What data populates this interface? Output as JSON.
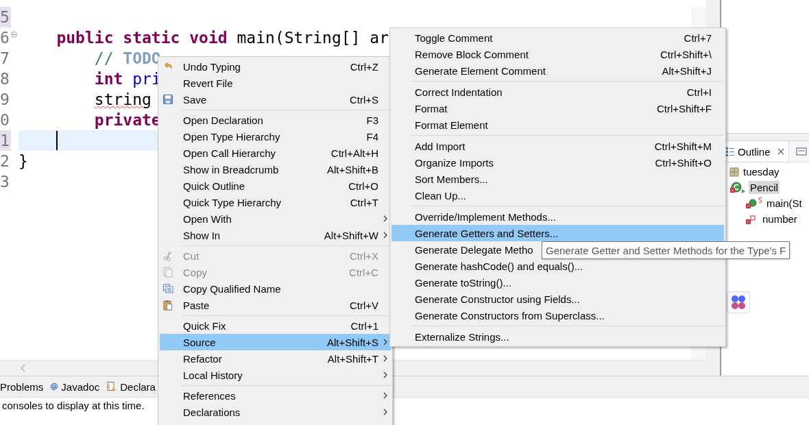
{
  "editor": {
    "lines": [
      {
        "number": "5",
        "marked": true,
        "folding": false,
        "current": false
      },
      {
        "number": "6",
        "marked": false,
        "folding": true,
        "current": false,
        "tokens": [
          {
            "text": "    public static void",
            "kind": "keyword"
          },
          {
            "text": " main(String[] ar",
            "kind": "plain"
          }
        ]
      },
      {
        "number": "7",
        "marked": false,
        "folding": false,
        "current": false,
        "tokens": [
          {
            "text": "        // ",
            "kind": "comment"
          },
          {
            "text": "TODO",
            "kind": "task"
          }
        ]
      },
      {
        "number": "8",
        "marked": false,
        "folding": false,
        "current": false,
        "tokens": [
          {
            "text": "        int",
            "kind": "keyword"
          },
          {
            "text": " pri",
            "kind": "field"
          }
        ]
      },
      {
        "number": "9",
        "marked": false,
        "folding": false,
        "current": false,
        "tokens": [
          {
            "text": "        string",
            "kind": "error"
          }
        ]
      },
      {
        "number": "0",
        "marked": false,
        "folding": false,
        "current": false,
        "tokens": [
          {
            "text": "        private",
            "kind": "keyword"
          }
        ]
      },
      {
        "number": "1",
        "marked": true,
        "folding": false,
        "current": true
      },
      {
        "number": "2",
        "marked": false,
        "folding": false,
        "current": false,
        "tokens": [
          {
            "text": "}",
            "kind": "plain"
          }
        ]
      },
      {
        "number": "3",
        "marked": false,
        "folding": false,
        "current": false
      }
    ]
  },
  "outline": {
    "tab": {
      "label": "Outline"
    },
    "items": [
      {
        "label": "tuesday",
        "kind": "package",
        "selected": false
      },
      {
        "label": "Pencil",
        "kind": "class",
        "selected": true,
        "children": [
          {
            "label": "main(St",
            "kind": "method",
            "static": true,
            "selected": false
          },
          {
            "label": "number",
            "kind": "field",
            "static": false,
            "selected": false
          }
        ]
      }
    ]
  },
  "bottom_panel": {
    "tabs": [
      {
        "label": "Problems",
        "kind": "plain"
      },
      {
        "label": "Javadoc",
        "kind": "javadoc"
      },
      {
        "label": "Declara",
        "kind": "declaration"
      }
    ],
    "message": "consoles to display at this time."
  },
  "context_menu": {
    "groups": [
      {
        "items": [
          {
            "label": "Undo Typing",
            "shortcut": "Ctrl+Z",
            "kind": "undo",
            "disabled": false,
            "selected": false,
            "submenu": false
          },
          {
            "label": "Revert File",
            "kind": "plain",
            "disabled": false,
            "selected": false,
            "submenu": false
          },
          {
            "label": "Save",
            "shortcut": "Ctrl+S",
            "kind": "save",
            "disabled": false,
            "selected": false,
            "submenu": false
          }
        ]
      },
      {
        "items": [
          {
            "label": "Open Declaration",
            "shortcut": "F3",
            "kind": "plain",
            "disabled": false,
            "selected": false,
            "submenu": false
          },
          {
            "label": "Open Type Hierarchy",
            "shortcut": "F4",
            "kind": "plain",
            "disabled": false,
            "selected": false,
            "submenu": false
          },
          {
            "label": "Open Call Hierarchy",
            "shortcut": "Ctrl+Alt+H",
            "kind": "plain",
            "disabled": false,
            "selected": false,
            "submenu": false
          },
          {
            "label": "Show in Breadcrumb",
            "shortcut": "Alt+Shift+B",
            "kind": "plain",
            "disabled": false,
            "selected": false,
            "submenu": false
          },
          {
            "label": "Quick Outline",
            "shortcut": "Ctrl+O",
            "kind": "plain",
            "disabled": false,
            "selected": false,
            "submenu": false
          },
          {
            "label": "Quick Type Hierarchy",
            "shortcut": "Ctrl+T",
            "kind": "plain",
            "disabled": false,
            "selected": false,
            "submenu": false
          },
          {
            "label": "Open With",
            "kind": "plain",
            "disabled": false,
            "selected": false,
            "submenu": true
          },
          {
            "label": "Show In",
            "shortcut": "Alt+Shift+W",
            "kind": "plain",
            "disabled": false,
            "selected": false,
            "submenu": true
          }
        ]
      },
      {
        "items": [
          {
            "label": "Cut",
            "shortcut": "Ctrl+X",
            "kind": "cut",
            "disabled": true,
            "selected": false,
            "submenu": false
          },
          {
            "label": "Copy",
            "shortcut": "Ctrl+C",
            "kind": "copy",
            "disabled": true,
            "selected": false,
            "submenu": false
          },
          {
            "label": "Copy Qualified Name",
            "kind": "copy-name",
            "disabled": false,
            "selected": false,
            "submenu": false
          },
          {
            "label": "Paste",
            "shortcut": "Ctrl+V",
            "kind": "paste",
            "disabled": false,
            "selected": false,
            "submenu": false
          }
        ]
      },
      {
        "items": [
          {
            "label": "Quick Fix",
            "shortcut": "Ctrl+1",
            "kind": "plain",
            "disabled": false,
            "selected": false,
            "submenu": false
          },
          {
            "label": "Source",
            "shortcut": "Alt+Shift+S",
            "kind": "plain",
            "disabled": false,
            "selected": true,
            "submenu": true
          },
          {
            "label": "Refactor",
            "shortcut": "Alt+Shift+T",
            "kind": "plain",
            "disabled": false,
            "selected": false,
            "submenu": true
          },
          {
            "label": "Local History",
            "kind": "plain",
            "disabled": false,
            "selected": false,
            "submenu": true
          }
        ]
      },
      {
        "items": [
          {
            "label": "References",
            "kind": "plain",
            "disabled": false,
            "selected": false,
            "submenu": true
          },
          {
            "label": "Declarations",
            "kind": "plain",
            "disabled": false,
            "selected": false,
            "submenu": true
          }
        ]
      }
    ]
  },
  "source_submenu": {
    "groups": [
      {
        "items": [
          {
            "label": "Toggle Comment",
            "shortcut": "Ctrl+7",
            "selected": false
          },
          {
            "label": "Remove Block Comment",
            "shortcut": "Ctrl+Shift+\\",
            "selected": false
          },
          {
            "label": "Generate Element Comment",
            "shortcut": "Alt+Shift+J",
            "selected": false
          }
        ]
      },
      {
        "items": [
          {
            "label": "Correct Indentation",
            "shortcut": "Ctrl+I",
            "selected": false
          },
          {
            "label": "Format",
            "shortcut": "Ctrl+Shift+F",
            "selected": false
          },
          {
            "label": "Format Element",
            "selected": false
          }
        ]
      },
      {
        "items": [
          {
            "label": "Add Import",
            "shortcut": "Ctrl+Shift+M",
            "selected": false
          },
          {
            "label": "Organize Imports",
            "shortcut": "Ctrl+Shift+O",
            "selected": false
          },
          {
            "label": "Sort Members...",
            "selected": false
          },
          {
            "label": "Clean Up...",
            "selected": false
          }
        ]
      },
      {
        "items": [
          {
            "label": "Override/Implement Methods...",
            "selected": false
          },
          {
            "label": "Generate Getters and Setters...",
            "selected": true
          },
          {
            "label": "Generate Delegate Metho",
            "selected": false
          },
          {
            "label": "Generate hashCode() and equals()...",
            "selected": false
          },
          {
            "label": "Generate toString()...",
            "selected": false
          },
          {
            "label": "Generate Constructor using Fields...",
            "selected": false
          },
          {
            "label": "Generate Constructors from Superclass...",
            "selected": false
          }
        ]
      },
      {
        "items": [
          {
            "label": "Externalize Strings...",
            "selected": false
          }
        ]
      }
    ]
  },
  "tooltip": "Generate Getter and Setter Methods for the Type's F"
}
